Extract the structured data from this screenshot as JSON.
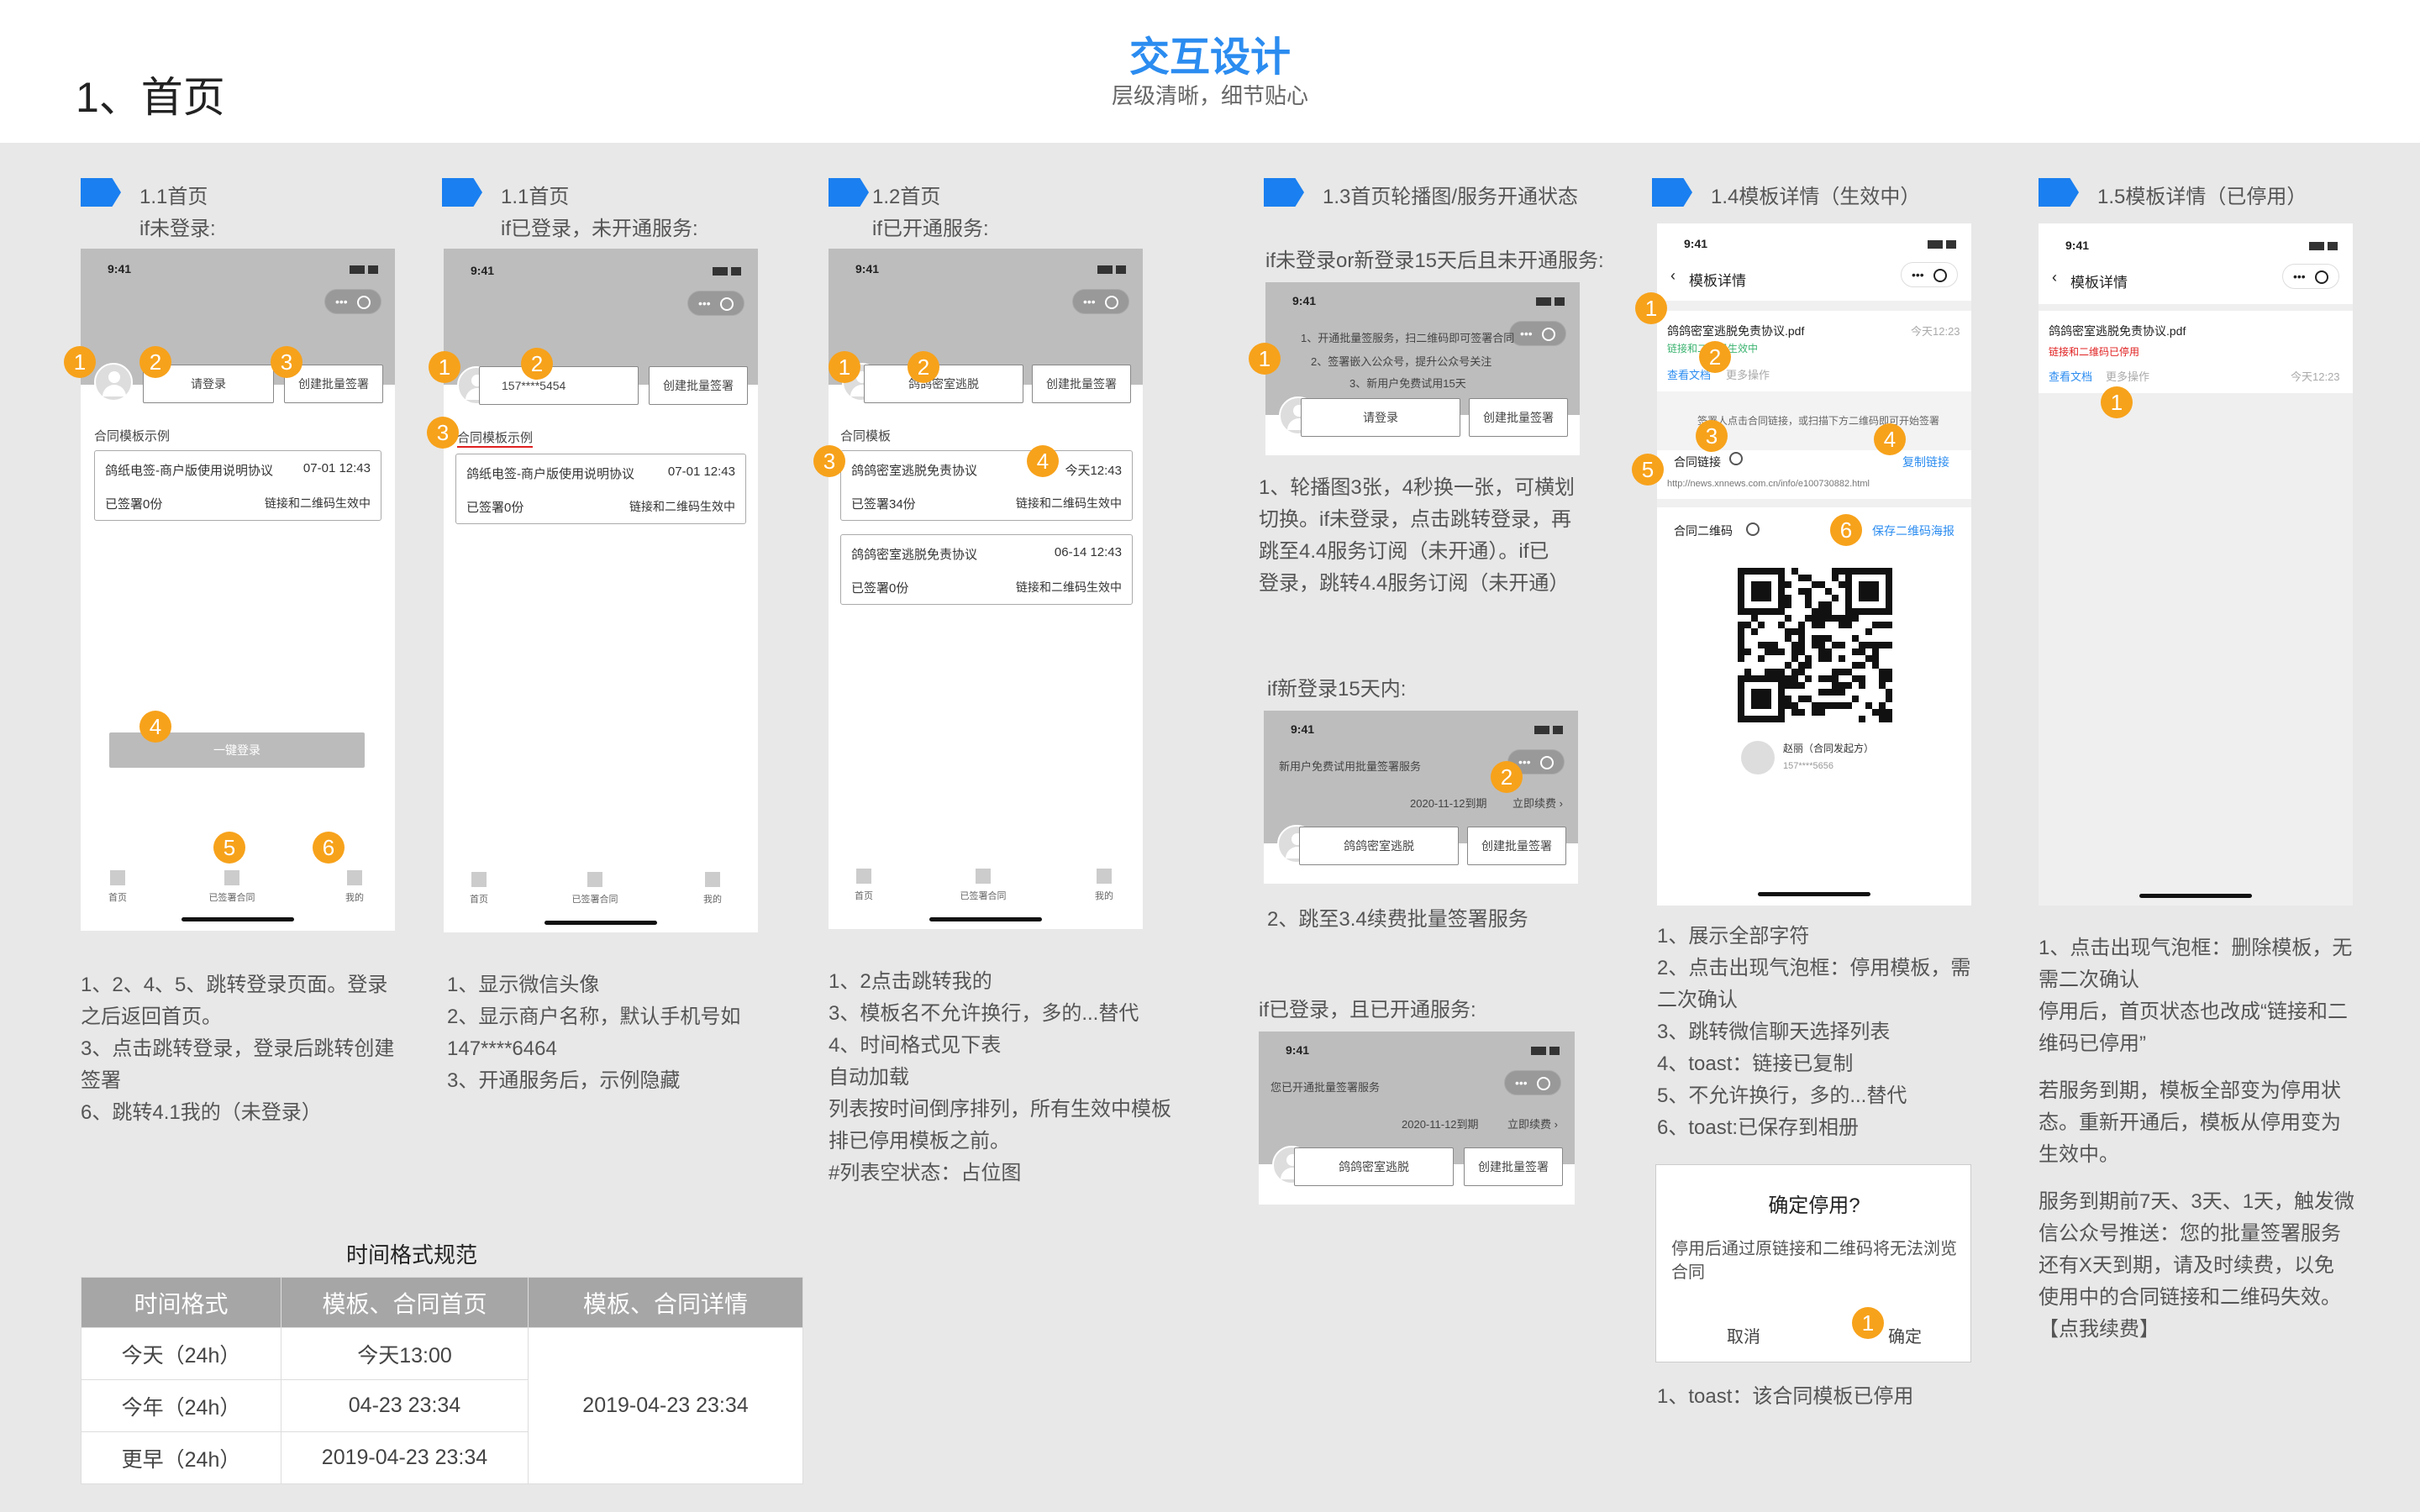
{
  "header": {
    "title": "交互设计",
    "subtitle": "层级清晰，细节贴心",
    "page_title": "1、首页"
  },
  "colors": {
    "accent": "#2b8cf0",
    "badge": "#f7a21b",
    "flag": "#1a7ff0"
  },
  "common": {
    "time": "9:41",
    "tab_home": "首页",
    "tab_signed": "已签署合同",
    "tab_mine": "我的",
    "create_btn": "创建批量签署",
    "contract_title": "鸽纸电签-商户版使用说明协议",
    "contract_date": "07-01 12:43",
    "signed_zero": "已签署0份",
    "link_active": "链接和二维码生效中",
    "shop_name": "鸽鸽密室逃脱",
    "contract2": "鸽鸽密室逃脱免责协议",
    "template_detail": "模板详情",
    "pdf_name": "鸽鸽密室逃脱免责协议.pdf",
    "today_time": "今天12:23"
  },
  "sections": {
    "s1": {
      "label": "1.1首页",
      "cond": "if未登录:",
      "login_btn": "请登录",
      "example": "合同模板示例",
      "one_key": "一键登录"
    },
    "s2": {
      "label": "1.1首页",
      "cond": "if已登录，未开通服务:",
      "phone": "157****5454",
      "example": "合同模板示例"
    },
    "s3": {
      "label": "1.2首页",
      "cond": "if已开通服务:",
      "list_title": "合同模板",
      "signed34": "已签署34份",
      "date2": "今天12:43",
      "date3": "06-14 12:43"
    },
    "s4": {
      "label": "1.3首页轮播图/服务开通状态",
      "cond1": "if未登录or新登录15天后且未开通服务:",
      "banner_l1": "1、开通批量签服务，扫二维码即可签署合同",
      "banner_l2": "2、签署嵌入公众号，提升公众号关注",
      "banner_l3": "3、新用户免费试用15天",
      "cond2": "if新登录15天内:",
      "trial": "新用户免费试用批量签署服务",
      "expire": "2020-11-12到期",
      "renew": "立即续费 ›",
      "cond3": "if已登录，且已开通服务:",
      "opened": "您已开通批量签署服务",
      "renew2": "立即续费 ›",
      "note_a": [
        "1、轮播图3张，4秒换一张，可横划",
        "切换。if未登录，点击跳转登录，再",
        "跳至4.4服务订阅（未开通）。if已",
        "登录，跳转4.4服务订阅（未开通）"
      ],
      "note_b": "2、跳至3.4续费批量签署服务"
    },
    "s5": {
      "label": "1.4模板详情（生效中）",
      "status_active": "链接和二维码生效中",
      "view_doc": "查看文档",
      "more_ops": "更多操作",
      "tip": "签署人点击合同链接，或扫描下方二维码即可开始签署",
      "link_label": "合同链接",
      "copy_link": "复制链接",
      "url": "http://news.xnnews.com.cn/info/e100730882.html",
      "qr_label": "合同二维码",
      "save_qr": "保存二维码海报",
      "sender": "赵丽（合同发起方）",
      "sender_phone": "157****5656",
      "notes": [
        "1、展示全部字符",
        "2、点击出现气泡框：停用模板，需",
        "二次确认",
        "3、跳转微信聊天选择列表",
        "4、toast：链接已复制",
        "5、不允许换行，多的...替代",
        "6、toast:已保存到相册"
      ],
      "dialog_title": "确定停用?",
      "dialog_body": "停用后通过原链接和二维码将无法浏览合同",
      "cancel": "取消",
      "confirm": "确定",
      "toast": "1、toast：该合同模板已停用"
    },
    "s6": {
      "label": "1.5模板详情（已停用）",
      "status_stopped": "链接和二维码已停用",
      "notes": [
        "1、点击出现气泡框：删除模板，无",
        "需二次确认",
        "停用后，首页状态也改成“链接和二",
        "维码已停用”",
        "",
        "若服务到期，模板全部变为停用状",
        "态。重新开通后，模板从停用变为",
        "生效中。",
        "",
        "服务到期前7天、3天、1天，触发微",
        "信公众号推送：您的批量签署服务",
        "还有X天到期，请及时续费，以免",
        "使用中的合同链接和二维码失效。",
        "【点我续费】"
      ]
    }
  },
  "notes1": [
    "1、2、4、5、跳转登录页面。登录",
    "之后返回首页。",
    "3、点击跳转登录，登录后跳转创建",
    "签署",
    "6、跳转4.1我的（未登录）"
  ],
  "notes2": [
    "1、显示微信头像",
    "2、显示商户名称，默认手机号如",
    "147****6464",
    "3、开通服务后，示例隐藏"
  ],
  "notes3": [
    "1、2点击跳转我的",
    "3、模板名不允许换行，多的...替代",
    "4、时间格式见下表",
    "",
    "自动加载",
    "列表按时间倒序排列，所有生效中模板",
    "排已停用模板之前。",
    "#列表空状态：占位图"
  ],
  "time_table": {
    "caption": "时间格式规范",
    "headers": [
      "时间格式",
      "模板、合同首页",
      "模板、合同详情"
    ],
    "rows": [
      [
        "今天（24h）",
        "今天13:00"
      ],
      [
        "今年（24h）",
        "04-23 23:34"
      ],
      [
        "更早（24h）",
        "2019-04-23 23:34"
      ]
    ],
    "detail": "2019-04-23 23:34"
  }
}
